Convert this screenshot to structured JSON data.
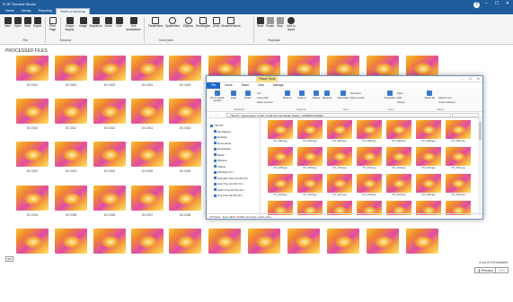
{
  "app": {
    "title": "FLIR Thermal Studio"
  },
  "tabs": [
    "Home",
    "Library",
    "Reporting",
    "Batch processing"
  ],
  "ribbon": {
    "buttons": [
      "New",
      "Open",
      "Save",
      "Export",
      "Print Page",
      "Output targets",
      "Image",
      "Sequence",
      "Scale",
      "Line",
      "Text annotations",
      "Parameters",
      "Spotmeters",
      "Ellipses",
      "Rectangles",
      "Lines",
      "Measurements",
      "Start",
      "Pause",
      "Stop",
      "Add to report"
    ],
    "groups": [
      "File",
      "General",
      "Insert jobs",
      "Playback"
    ]
  },
  "main": {
    "section_title": "PROCESSED FILES",
    "row_labels": [
      [
        "DV-0001",
        "DV-0002",
        "DV-0003",
        "DV-0004",
        "DV-0005"
      ],
      [
        "DV-0010",
        "DV-0012",
        "DV-0013",
        "DV-0014",
        "DV-0015"
      ],
      [
        "DV-0022",
        "DV-0023",
        "DV-0024",
        "DV-0025",
        "DV-0026"
      ],
      [
        "DV-0034",
        "DV-0035",
        "DV-0036",
        "DV-0037",
        "DV-0038"
      ]
    ],
    "page_info": "6 out of 176 selected",
    "prev_label": "Previous",
    "next_label": "Next"
  },
  "explorer": {
    "picture_tools": "Picture Tools",
    "tabs": [
      "File",
      "Home",
      "Share",
      "View",
      "Manage"
    ],
    "ribbon_buttons": [
      "Pin to Quick access",
      "Copy",
      "Paste",
      "Move to",
      "Copy to",
      "Delete",
      "Rename",
      "New folder",
      "Properties",
      "Select all"
    ],
    "ribbon_small": [
      "Cut",
      "Copy path",
      "Paste shortcut",
      "New item",
      "Easy access",
      "Open",
      "Edit",
      "History",
      "Select none",
      "Invert selection"
    ],
    "groups": [
      "Clipboard",
      "Organize",
      "New",
      "Open",
      "Select"
    ],
    "address": [
      "This PC",
      "Documents",
      "FLIR",
      "FLIR Thermal Studio Output",
      "20180517125042"
    ],
    "nav": [
      "This PC",
      "3D Objects",
      "Desktop",
      "Documents",
      "Downloads",
      "Music",
      "Pictures",
      "Videos",
      "Windows (C:)",
      "swsusb1 (\\\\se.win.flir) (F:)",
      "swtr (\\\\se.win.flir) (G:)",
      "swirlt (\\\\se.win.flir) (H:)",
      "Proj (\\\\se.win.flir) (P:)"
    ],
    "files": [
      [
        "DV_0001.jpg",
        "DV_0002.jpg",
        "DV_0003.jpg",
        "DV_0004.jpg",
        "DV_0005.jpg",
        "DV_0006.jpg",
        "DV_0007.jpg"
      ],
      [
        "DV_0008.jpg",
        "DV_0009.jpg",
        "DV_0010.jpg",
        "DV_0011.jpg",
        "DV_0012.jpg",
        "DV_0013.jpg",
        "DV_0014.jpg"
      ],
      [
        "DV_0015.jpg",
        "DV_0016.jpg",
        "DV_0017.jpg",
        "DV_0018.jpg",
        "DV_0019.jpg",
        "DV_0020.jpg",
        "DV_0021.jpg"
      ]
    ],
    "status": {
      "items": "176 items",
      "sync": "Sync status:",
      "error": "Files can't sync. Learn more..."
    }
  }
}
